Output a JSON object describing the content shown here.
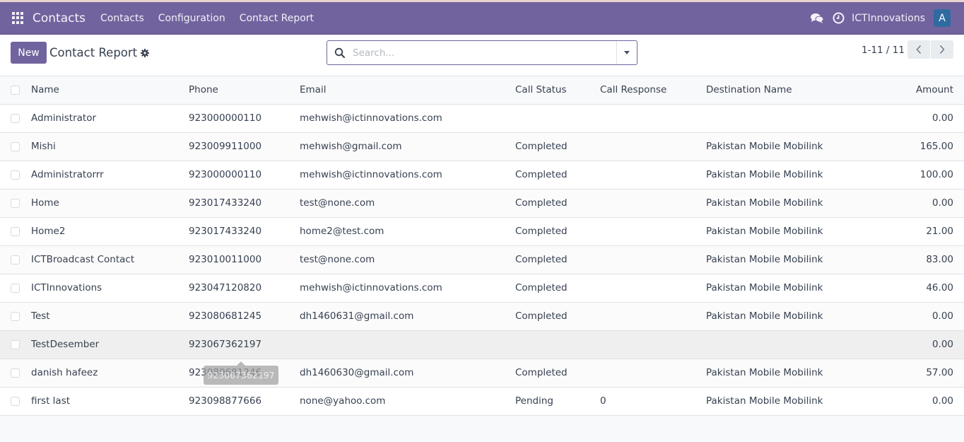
{
  "topbar": {
    "app_name": "Contacts",
    "menu": [
      "Contacts",
      "Configuration",
      "Contact Report"
    ],
    "company": "ICTInnovations",
    "avatar_initial": "A",
    "icons": {
      "apps": "apps-grid-icon",
      "chat": "chat-icon",
      "activity": "clock-icon"
    }
  },
  "control_panel": {
    "new_label": "New",
    "title": "Contact Report",
    "search_placeholder": "Search...",
    "search_value": "",
    "pager": "1-11 / 11"
  },
  "colors": {
    "brand": "#71639e",
    "avatar": "#2f6ba1"
  },
  "table": {
    "columns": [
      "Name",
      "Phone",
      "Email",
      "Call Status",
      "Call Response",
      "Destination Name",
      "Amount"
    ],
    "rows": [
      {
        "name": "Administrator",
        "phone": "923000000110",
        "email": "mehwish@ictinnovations.com",
        "call_status": "",
        "call_response": "",
        "destination": "",
        "amount": "0.00"
      },
      {
        "name": "Mishi",
        "phone": "923009911000",
        "email": "mehwish@gmail.com",
        "call_status": "Completed",
        "call_response": "",
        "destination": "Pakistan Mobile Mobilink",
        "amount": "165.00"
      },
      {
        "name": "Administratorrr",
        "phone": "923000000110",
        "email": "mehwish@ictinnovations.com",
        "call_status": "Completed",
        "call_response": "",
        "destination": "Pakistan Mobile Mobilink",
        "amount": "100.00"
      },
      {
        "name": "Home",
        "phone": "923017433240",
        "email": "test@none.com",
        "call_status": "Completed",
        "call_response": "",
        "destination": "Pakistan Mobile Mobilink",
        "amount": "0.00"
      },
      {
        "name": "Home2",
        "phone": "923017433240",
        "email": "home2@test.com",
        "call_status": "Completed",
        "call_response": "",
        "destination": "Pakistan Mobile Mobilink",
        "amount": "21.00"
      },
      {
        "name": "ICTBroadcast Contact",
        "phone": "923010011000",
        "email": "test@none.com",
        "call_status": "Completed",
        "call_response": "",
        "destination": "Pakistan Mobile Mobilink",
        "amount": "83.00"
      },
      {
        "name": "ICTInnovations",
        "phone": "923047120820",
        "email": "mehwish@ictinnovations.com",
        "call_status": "Completed",
        "call_response": "",
        "destination": "Pakistan Mobile Mobilink",
        "amount": "46.00"
      },
      {
        "name": "Test",
        "phone": "923080681245",
        "email": "dh1460631@gmail.com",
        "call_status": "Completed",
        "call_response": "",
        "destination": "Pakistan Mobile Mobilink",
        "amount": "0.00"
      },
      {
        "name": "TestDesember",
        "phone": "923067362197",
        "email": "",
        "call_status": "",
        "call_response": "",
        "destination": "",
        "amount": "0.00"
      },
      {
        "name": "danish hafeez",
        "phone": "923080681246",
        "email": "dh1460630@gmail.com",
        "call_status": "Completed",
        "call_response": "",
        "destination": "Pakistan Mobile Mobilink",
        "amount": "57.00"
      },
      {
        "name": "first last",
        "phone": "923098877666",
        "email": "none@yahoo.com",
        "call_status": "Pending",
        "call_response": "0",
        "destination": "Pakistan Mobile Mobilink",
        "amount": "0.00"
      }
    ],
    "hovered_row_index": 8
  },
  "tooltip": {
    "text": "923067362197"
  }
}
